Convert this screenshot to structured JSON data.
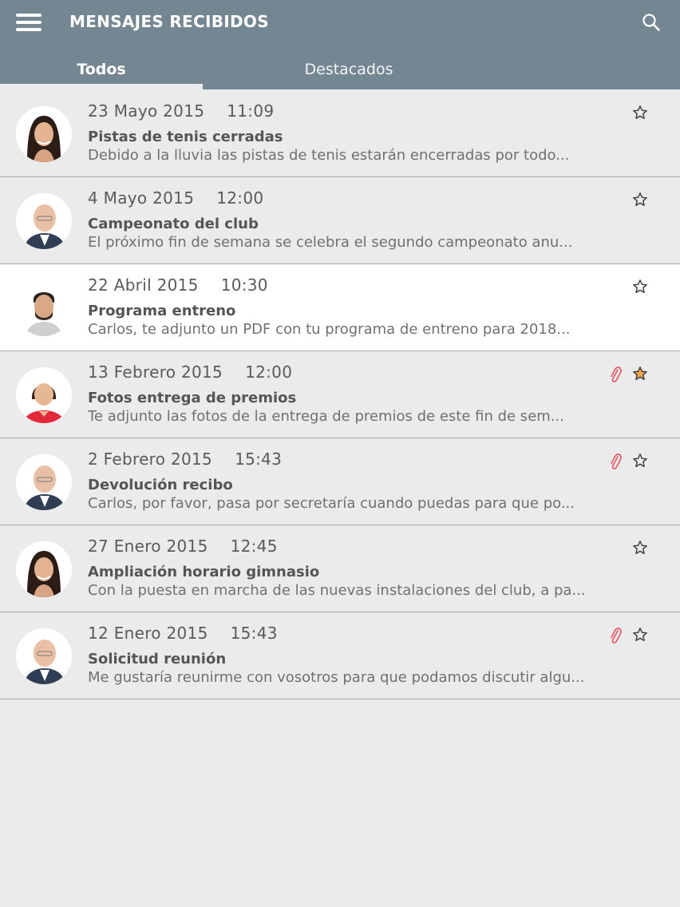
{
  "header": {
    "title": "MENSAJES RECIBIDOS",
    "menu_icon": "menu-icon",
    "search_icon": "search-icon",
    "bg_color": "#738692"
  },
  "tabs": [
    {
      "label": "Todos",
      "selected": true
    },
    {
      "label": "Destacados",
      "selected": false
    }
  ],
  "messages": [
    {
      "date": "23 Mayo 2015",
      "time": "11:09",
      "subject": "Pistas de tenis cerradas",
      "preview": "Debido a la lluvia las pistas de tenis estarán encerradas por todo...",
      "starred": false,
      "attachment": false,
      "avatar": "woman-dark-hair"
    },
    {
      "date": "4 Mayo 2015",
      "time": "12:00",
      "subject": "Campeonato del club",
      "preview": "El próximo fin de semana se celebra el segundo campeonato anu...",
      "starred": false,
      "attachment": false,
      "avatar": "man-bald"
    },
    {
      "date": "22 Abril 2015",
      "time": "10:30",
      "subject": "Programa entreno",
      "preview": "Carlos, te adjunto un PDF con tu programa de entreno para 2018...",
      "starred": false,
      "attachment": false,
      "avatar": "man-beard"
    },
    {
      "date": "13 Febrero 2015",
      "time": "12:00",
      "subject": "Fotos entrega de premios",
      "preview": "Te adjunto las fotos de la entrega de premios de este fin de sem...",
      "starred": true,
      "attachment": true,
      "avatar": "woman-red-top"
    },
    {
      "date": "2 Febrero 2015",
      "time": "15:43",
      "subject": "Devolución recibo",
      "preview": "Carlos, por favor, pasa por secretaría cuando puedas para que po...",
      "starred": false,
      "attachment": true,
      "avatar": "man-bald"
    },
    {
      "date": "27 Enero 2015",
      "time": "12:45",
      "subject": "Ampliación horario gimnasio",
      "preview": "Con la puesta en marcha de las nuevas instalaciones del club, a pa...",
      "starred": false,
      "attachment": false,
      "avatar": "woman-dark-hair"
    },
    {
      "date": "12 Enero 2015",
      "time": "15:43",
      "subject": "Solicitud reunión",
      "preview": "Me gustaría reunirme con vosotros para que podamos discutir algu...",
      "starred": false,
      "attachment": true,
      "avatar": "man-bald"
    }
  ],
  "colors": {
    "star_active": "#f3a64a",
    "attachment": "#e05a66",
    "row_selected": "#ffffff"
  }
}
